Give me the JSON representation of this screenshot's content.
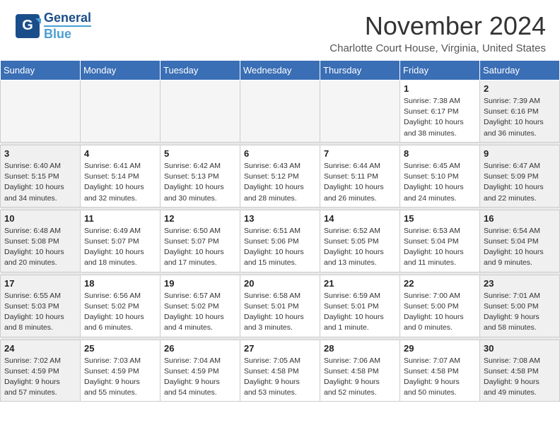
{
  "header": {
    "logo_general": "General",
    "logo_blue": "Blue",
    "month_title": "November 2024",
    "location": "Charlotte Court House, Virginia, United States"
  },
  "days_of_week": [
    "Sunday",
    "Monday",
    "Tuesday",
    "Wednesday",
    "Thursday",
    "Friday",
    "Saturday"
  ],
  "weeks": [
    [
      {
        "day": "",
        "info": "",
        "empty": true
      },
      {
        "day": "",
        "info": "",
        "empty": true
      },
      {
        "day": "",
        "info": "",
        "empty": true
      },
      {
        "day": "",
        "info": "",
        "empty": true
      },
      {
        "day": "",
        "info": "",
        "empty": true
      },
      {
        "day": "1",
        "info": "Sunrise: 7:38 AM\nSunset: 6:17 PM\nDaylight: 10 hours\nand 38 minutes."
      },
      {
        "day": "2",
        "info": "Sunrise: 7:39 AM\nSunset: 6:16 PM\nDaylight: 10 hours\nand 36 minutes."
      }
    ],
    [
      {
        "day": "3",
        "info": "Sunrise: 6:40 AM\nSunset: 5:15 PM\nDaylight: 10 hours\nand 34 minutes."
      },
      {
        "day": "4",
        "info": "Sunrise: 6:41 AM\nSunset: 5:14 PM\nDaylight: 10 hours\nand 32 minutes."
      },
      {
        "day": "5",
        "info": "Sunrise: 6:42 AM\nSunset: 5:13 PM\nDaylight: 10 hours\nand 30 minutes."
      },
      {
        "day": "6",
        "info": "Sunrise: 6:43 AM\nSunset: 5:12 PM\nDaylight: 10 hours\nand 28 minutes."
      },
      {
        "day": "7",
        "info": "Sunrise: 6:44 AM\nSunset: 5:11 PM\nDaylight: 10 hours\nand 26 minutes."
      },
      {
        "day": "8",
        "info": "Sunrise: 6:45 AM\nSunset: 5:10 PM\nDaylight: 10 hours\nand 24 minutes."
      },
      {
        "day": "9",
        "info": "Sunrise: 6:47 AM\nSunset: 5:09 PM\nDaylight: 10 hours\nand 22 minutes."
      }
    ],
    [
      {
        "day": "10",
        "info": "Sunrise: 6:48 AM\nSunset: 5:08 PM\nDaylight: 10 hours\nand 20 minutes."
      },
      {
        "day": "11",
        "info": "Sunrise: 6:49 AM\nSunset: 5:07 PM\nDaylight: 10 hours\nand 18 minutes."
      },
      {
        "day": "12",
        "info": "Sunrise: 6:50 AM\nSunset: 5:07 PM\nDaylight: 10 hours\nand 17 minutes."
      },
      {
        "day": "13",
        "info": "Sunrise: 6:51 AM\nSunset: 5:06 PM\nDaylight: 10 hours\nand 15 minutes."
      },
      {
        "day": "14",
        "info": "Sunrise: 6:52 AM\nSunset: 5:05 PM\nDaylight: 10 hours\nand 13 minutes."
      },
      {
        "day": "15",
        "info": "Sunrise: 6:53 AM\nSunset: 5:04 PM\nDaylight: 10 hours\nand 11 minutes."
      },
      {
        "day": "16",
        "info": "Sunrise: 6:54 AM\nSunset: 5:04 PM\nDaylight: 10 hours\nand 9 minutes."
      }
    ],
    [
      {
        "day": "17",
        "info": "Sunrise: 6:55 AM\nSunset: 5:03 PM\nDaylight: 10 hours\nand 8 minutes."
      },
      {
        "day": "18",
        "info": "Sunrise: 6:56 AM\nSunset: 5:02 PM\nDaylight: 10 hours\nand 6 minutes."
      },
      {
        "day": "19",
        "info": "Sunrise: 6:57 AM\nSunset: 5:02 PM\nDaylight: 10 hours\nand 4 minutes."
      },
      {
        "day": "20",
        "info": "Sunrise: 6:58 AM\nSunset: 5:01 PM\nDaylight: 10 hours\nand 3 minutes."
      },
      {
        "day": "21",
        "info": "Sunrise: 6:59 AM\nSunset: 5:01 PM\nDaylight: 10 hours\nand 1 minute."
      },
      {
        "day": "22",
        "info": "Sunrise: 7:00 AM\nSunset: 5:00 PM\nDaylight: 10 hours\nand 0 minutes."
      },
      {
        "day": "23",
        "info": "Sunrise: 7:01 AM\nSunset: 5:00 PM\nDaylight: 9 hours\nand 58 minutes."
      }
    ],
    [
      {
        "day": "24",
        "info": "Sunrise: 7:02 AM\nSunset: 4:59 PM\nDaylight: 9 hours\nand 57 minutes."
      },
      {
        "day": "25",
        "info": "Sunrise: 7:03 AM\nSunset: 4:59 PM\nDaylight: 9 hours\nand 55 minutes."
      },
      {
        "day": "26",
        "info": "Sunrise: 7:04 AM\nSunset: 4:59 PM\nDaylight: 9 hours\nand 54 minutes."
      },
      {
        "day": "27",
        "info": "Sunrise: 7:05 AM\nSunset: 4:58 PM\nDaylight: 9 hours\nand 53 minutes."
      },
      {
        "day": "28",
        "info": "Sunrise: 7:06 AM\nSunset: 4:58 PM\nDaylight: 9 hours\nand 52 minutes."
      },
      {
        "day": "29",
        "info": "Sunrise: 7:07 AM\nSunset: 4:58 PM\nDaylight: 9 hours\nand 50 minutes."
      },
      {
        "day": "30",
        "info": "Sunrise: 7:08 AM\nSunset: 4:58 PM\nDaylight: 9 hours\nand 49 minutes."
      }
    ]
  ]
}
